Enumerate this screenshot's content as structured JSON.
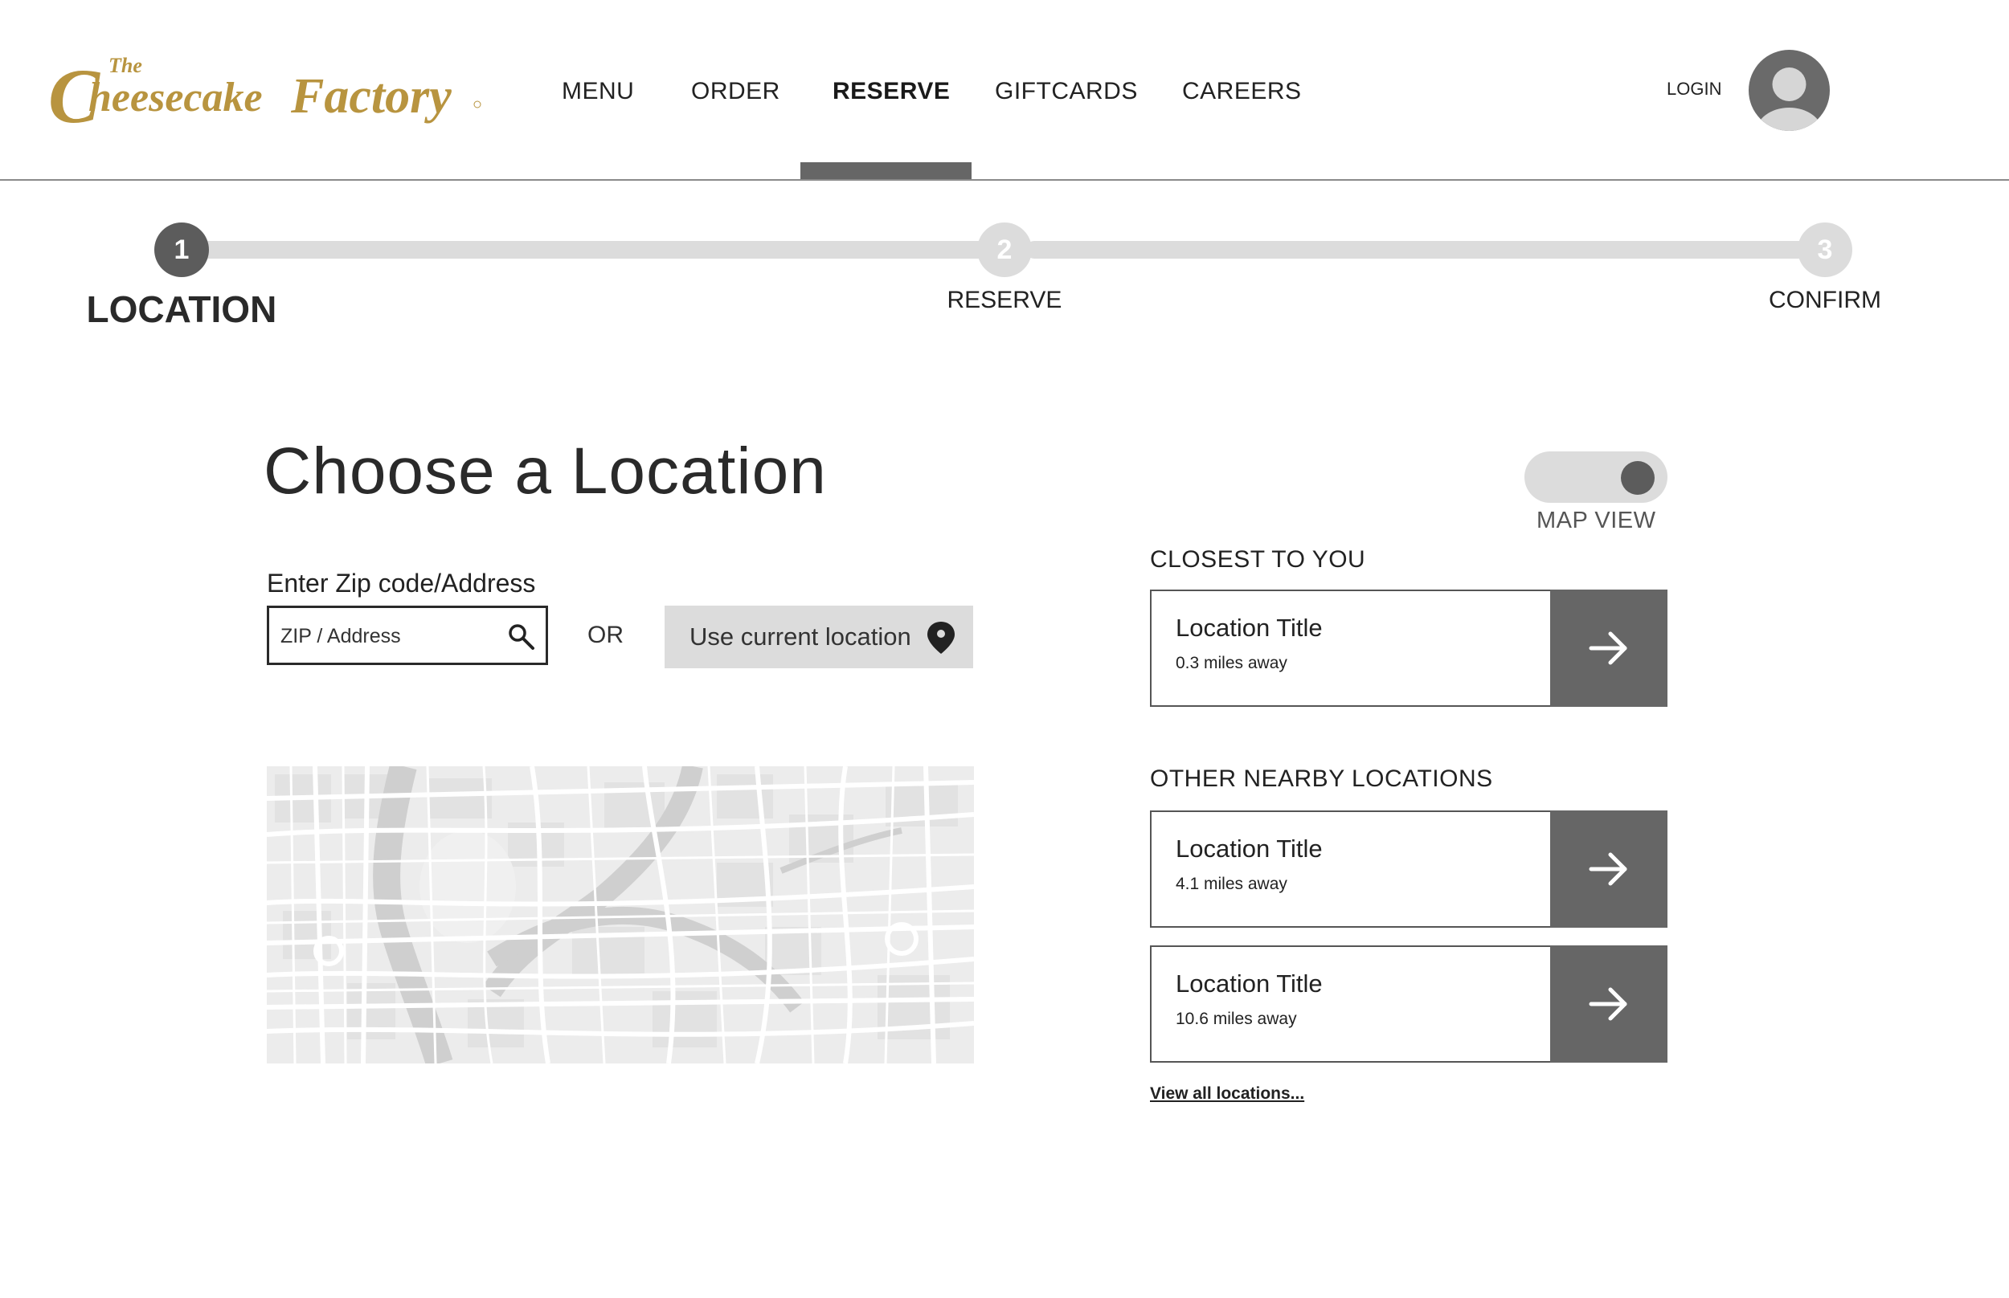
{
  "header": {
    "logo_text": "The Cheesecake Factory",
    "brand_color": "#B8943F",
    "nav": [
      {
        "label": "MENU",
        "active": false
      },
      {
        "label": "ORDER",
        "active": false
      },
      {
        "label": "RESERVE",
        "active": true
      },
      {
        "label": "GIFTCARDS",
        "active": false
      },
      {
        "label": "CAREERS",
        "active": false
      }
    ],
    "login_label": "LOGIN",
    "avatar_icon": "user-avatar-icon"
  },
  "stepper": {
    "current_step": 1,
    "steps": [
      {
        "number": "1",
        "label": "LOCATION"
      },
      {
        "number": "2",
        "label": "RESERVE"
      },
      {
        "number": "3",
        "label": "CONFIRM"
      }
    ]
  },
  "main": {
    "title": "Choose a Location",
    "input_label": "Enter Zip code/Address",
    "search_placeholder": "ZIP / Address",
    "search_value": "",
    "search_icon": "search-icon",
    "or_text": "OR",
    "use_location_label": "Use current location",
    "use_location_icon": "location-pin-icon"
  },
  "panel": {
    "map_view_label": "MAP VIEW",
    "map_view_on": true,
    "closest_heading": "CLOSEST TO YOU",
    "closest": {
      "title": "Location Title",
      "distance": "0.3 miles away"
    },
    "nearby_heading": "OTHER NEARBY LOCATIONS",
    "nearby": [
      {
        "title": "Location Title",
        "distance": "4.1 miles away"
      },
      {
        "title": "Location Title",
        "distance": "10.6 miles away"
      }
    ],
    "arrow_icon": "arrow-right-icon",
    "view_all_label": "View all locations..."
  },
  "colors": {
    "accent_dark": "#666666",
    "step_active": "#5c5c5c",
    "step_inactive": "#dcdcdc"
  }
}
